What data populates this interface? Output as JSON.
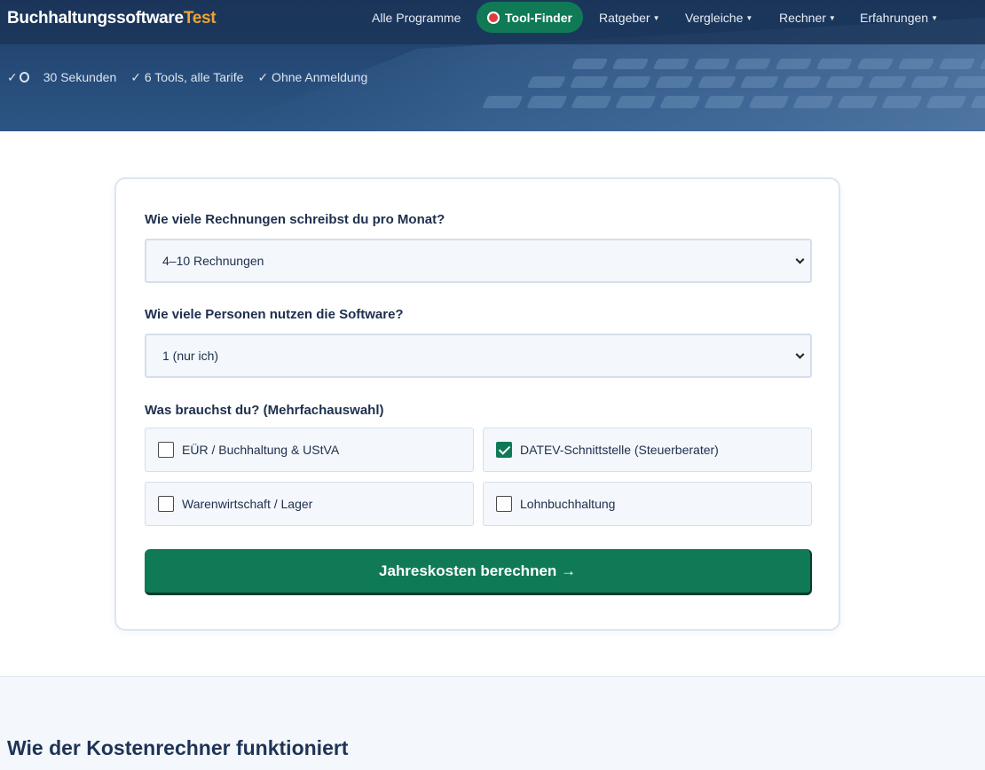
{
  "header": {
    "logo_main": "Buchhaltungssoftware",
    "logo_accent": "Test",
    "nav": {
      "all_programs": "Alle Programme",
      "tool_finder": "Tool-Finder",
      "guides": "Ratgeber",
      "comparisons": "Vergleiche",
      "calculators": "Rechner",
      "experiences": "Erfahrungen"
    },
    "benefits": [
      "✓",
      "30 Sekunden",
      "✓ 6 Tools, alle Tarife",
      "✓ Ohne Anmeldung"
    ]
  },
  "form": {
    "q_invoices": "Wie viele Rechnungen schreibst du pro Monat?",
    "invoices_value": "4–10 Rechnungen",
    "q_users": "Wie viele Personen nutzen die Software?",
    "users_value": "1 (nur ich)",
    "q_needs": "Was brauchst du? (Mehrfachauswahl)",
    "options": [
      {
        "label": "EÜR / Buchhaltung & UStVA",
        "checked": false
      },
      {
        "label": "DATEV-Schnittstelle (Steuerberater)",
        "checked": true
      },
      {
        "label": "Warenwirtschaft / Lager",
        "checked": false
      },
      {
        "label": "Lohnbuchhaltung",
        "checked": false
      }
    ],
    "submit": "Jahreskosten berechnen →"
  },
  "section": {
    "title": "Wie der Kostenrechner funktioniert"
  },
  "colors": {
    "brand_green": "#0f7a55",
    "header_blue": "#1d3a63",
    "logo_accent": "#f0a431"
  }
}
